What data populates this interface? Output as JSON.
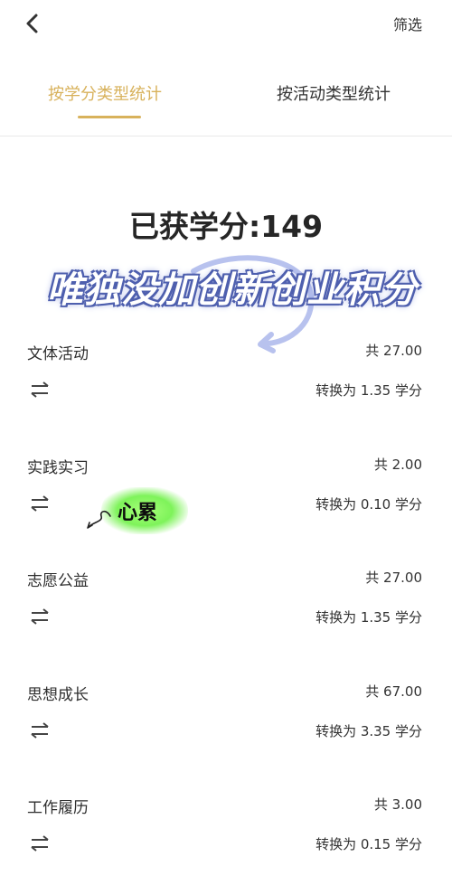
{
  "header": {
    "filter_label": "筛选"
  },
  "tabs": [
    {
      "label": "按学分类型统计",
      "active": true
    },
    {
      "label": "按活动类型统计",
      "active": false
    }
  ],
  "summary": {
    "total_label": "已获学分:149"
  },
  "overlay": {
    "caption": "唯独没加创新创业积分"
  },
  "sticker": {
    "text": "心累"
  },
  "rows": [
    {
      "name": "文体活动",
      "total": "共 27.00",
      "converted": "转换为 1.35 学分"
    },
    {
      "name": "实践实习",
      "total": "共 2.00",
      "converted": "转换为 0.10 学分"
    },
    {
      "name": "志愿公益",
      "total": "共 27.00",
      "converted": "转换为 1.35 学分"
    },
    {
      "name": "思想成长",
      "total": "共 67.00",
      "converted": "转换为 3.35 学分"
    },
    {
      "name": "工作履历",
      "total": "共 3.00",
      "converted": "转换为 0.15 学分"
    }
  ],
  "colors": {
    "accent": "#d8b25c",
    "sticker_glow": "#7ef35a",
    "overlay_outline": "#4e5fae"
  },
  "icons": {
    "back": "chevron-left-icon",
    "swap": "swap-arrows-icon"
  }
}
